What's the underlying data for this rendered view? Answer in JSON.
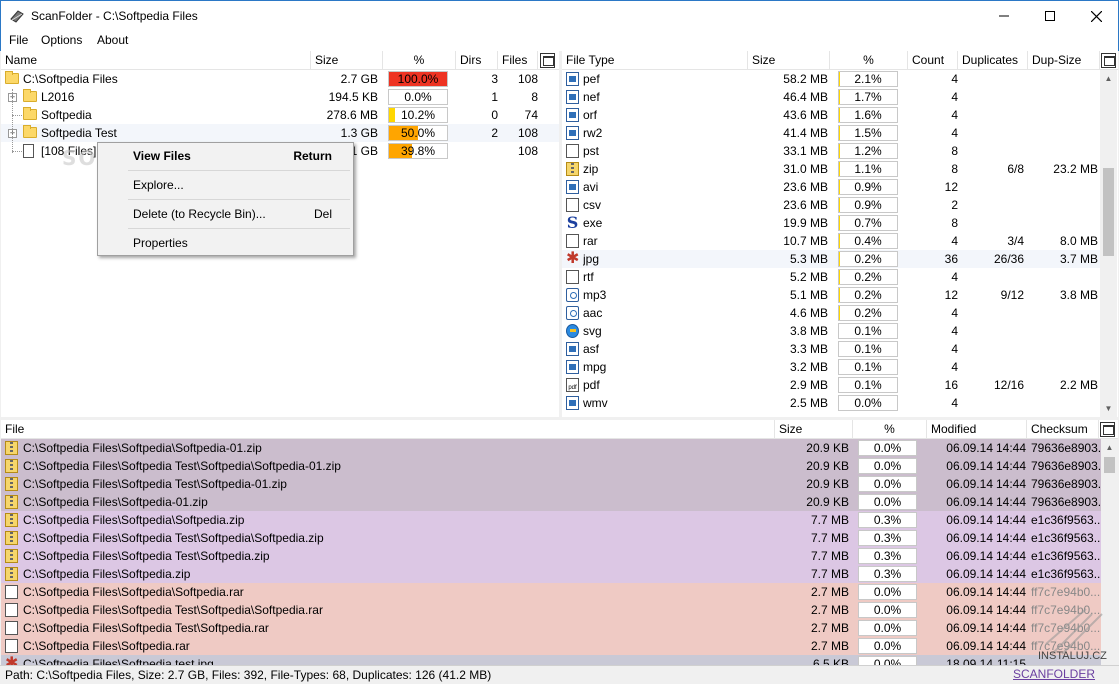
{
  "window": {
    "title": "ScanFolder - C:\\Softpedia Files",
    "minimize_glyph": "—",
    "maximize_glyph": "☐",
    "close_glyph": "✕"
  },
  "menu": [
    "File",
    "Options",
    "About"
  ],
  "folder_pane": {
    "headers": {
      "name": "Name",
      "size": "Size",
      "pct": "%",
      "dirs": "Dirs",
      "files": "Files"
    },
    "rows": [
      {
        "name": "C:\\Softpedia Files",
        "size": "2.7 GB",
        "pct": "100.0%",
        "pct_value": 100.0,
        "bar_color": "#ee3322",
        "dirs": "3",
        "files": "108",
        "icon": "folder-icon",
        "level": 0
      },
      {
        "name": "L2016",
        "size": "194.5 KB",
        "pct": "0.0%",
        "pct_value": 0.0,
        "bar_color": "#ffd700",
        "dirs": "1",
        "files": "8",
        "icon": "folder-icon",
        "level": 1,
        "expander": "+"
      },
      {
        "name": "Softpedia",
        "size": "278.6 MB",
        "pct": "10.2%",
        "pct_value": 10.2,
        "bar_color": "#ffd700",
        "dirs": "0",
        "files": "74",
        "icon": "folder-icon",
        "level": 1
      },
      {
        "name": "Softpedia Test",
        "size": "1.3 GB",
        "pct": "50.0%",
        "pct_value": 50.0,
        "bar_color": "#ffa500",
        "dirs": "2",
        "files": "108",
        "icon": "folder-icon",
        "level": 1,
        "expander": "+"
      },
      {
        "name": "[108 Files]",
        "size": "1 GB",
        "pct": "39.8%",
        "pct_value": 39.8,
        "bar_color": "#ffa500",
        "dirs": "",
        "files": "108",
        "icon": "file-icon",
        "level": 1
      }
    ]
  },
  "context_menu": {
    "items": [
      {
        "label": "View Files",
        "shortcut": "Return",
        "bold": true
      },
      {
        "label": "Explore...",
        "shortcut": ""
      },
      {
        "label": "Delete (to Recycle Bin)...",
        "shortcut": "Del"
      },
      {
        "label": "Properties",
        "shortcut": ""
      }
    ]
  },
  "watermark": "SOFTPEDIA",
  "type_pane": {
    "headers": {
      "type": "File Type",
      "size": "Size",
      "pct": "%",
      "count": "Count",
      "dups": "Duplicates",
      "dupsize": "Dup-Size"
    },
    "rows": [
      {
        "type": "pef",
        "size": "58.2 MB",
        "pct": "2.1%",
        "pct_value": 2.1,
        "count": "4",
        "dups": "",
        "dupsize": "",
        "icon": "img"
      },
      {
        "type": "nef",
        "size": "46.4 MB",
        "pct": "1.7%",
        "pct_value": 1.7,
        "count": "4",
        "dups": "",
        "dupsize": "",
        "icon": "img"
      },
      {
        "type": "orf",
        "size": "43.6 MB",
        "pct": "1.6%",
        "pct_value": 1.6,
        "count": "4",
        "dups": "",
        "dupsize": "",
        "icon": "img"
      },
      {
        "type": "rw2",
        "size": "41.4 MB",
        "pct": "1.5%",
        "pct_value": 1.5,
        "count": "4",
        "dups": "",
        "dupsize": "",
        "icon": "img"
      },
      {
        "type": "pst",
        "size": "33.1 MB",
        "pct": "1.2%",
        "pct_value": 1.2,
        "count": "8",
        "dups": "",
        "dupsize": "",
        "icon": "doc"
      },
      {
        "type": "zip",
        "size": "31.0 MB",
        "pct": "1.1%",
        "pct_value": 1.1,
        "count": "8",
        "dups": "6/8",
        "dupsize": "23.2 MB",
        "icon": "zip"
      },
      {
        "type": "avi",
        "size": "23.6 MB",
        "pct": "0.9%",
        "pct_value": 0.9,
        "count": "12",
        "dups": "",
        "dupsize": "",
        "icon": "img"
      },
      {
        "type": "csv",
        "size": "23.6 MB",
        "pct": "0.9%",
        "pct_value": 0.9,
        "count": "2",
        "dups": "",
        "dupsize": "",
        "icon": "doc"
      },
      {
        "type": "exe",
        "size": "19.9 MB",
        "pct": "0.7%",
        "pct_value": 0.7,
        "count": "8",
        "dups": "",
        "dupsize": "",
        "icon": "exe"
      },
      {
        "type": "rar",
        "size": "10.7 MB",
        "pct": "0.4%",
        "pct_value": 0.4,
        "count": "4",
        "dups": "3/4",
        "dupsize": "8.0 MB",
        "icon": "doc"
      },
      {
        "type": "jpg",
        "size": "5.3 MB",
        "pct": "0.2%",
        "pct_value": 0.2,
        "count": "36",
        "dups": "26/36",
        "dupsize": "3.7 MB",
        "icon": "jpg",
        "highlight": true
      },
      {
        "type": "rtf",
        "size": "5.2 MB",
        "pct": "0.2%",
        "pct_value": 0.2,
        "count": "4",
        "dups": "",
        "dupsize": "",
        "icon": "doc"
      },
      {
        "type": "mp3",
        "size": "5.1 MB",
        "pct": "0.2%",
        "pct_value": 0.2,
        "count": "12",
        "dups": "9/12",
        "dupsize": "3.8 MB",
        "icon": "mp3"
      },
      {
        "type": "aac",
        "size": "4.6 MB",
        "pct": "0.2%",
        "pct_value": 0.2,
        "count": "4",
        "dups": "",
        "dupsize": "",
        "icon": "mp3"
      },
      {
        "type": "svg",
        "size": "3.8 MB",
        "pct": "0.1%",
        "pct_value": 0.1,
        "count": "4",
        "dups": "",
        "dupsize": "",
        "icon": "svg"
      },
      {
        "type": "asf",
        "size": "3.3 MB",
        "pct": "0.1%",
        "pct_value": 0.1,
        "count": "4",
        "dups": "",
        "dupsize": "",
        "icon": "img"
      },
      {
        "type": "mpg",
        "size": "3.2 MB",
        "pct": "0.1%",
        "pct_value": 0.1,
        "count": "4",
        "dups": "",
        "dupsize": "",
        "icon": "img"
      },
      {
        "type": "pdf",
        "size": "2.9 MB",
        "pct": "0.1%",
        "pct_value": 0.1,
        "count": "16",
        "dups": "12/16",
        "dupsize": "2.2 MB",
        "icon": "pdf"
      },
      {
        "type": "wmv",
        "size": "2.5 MB",
        "pct": "0.0%",
        "pct_value": 0.0,
        "count": "4",
        "dups": "",
        "dupsize": "",
        "icon": "img"
      }
    ]
  },
  "file_pane": {
    "headers": {
      "file": "File",
      "size": "Size",
      "pct": "%",
      "modified": "Modified",
      "checksum": "Checksum"
    },
    "rows": [
      {
        "file": "C:\\Softpedia Files\\Softpedia\\Softpedia-01.zip",
        "size": "20.9 KB",
        "pct": "0.0%",
        "date": "06.09.14",
        "time": "14:44",
        "checksum": "79636e8903...",
        "bg": "#cbbdcd",
        "icon": "zip"
      },
      {
        "file": "C:\\Softpedia Files\\Softpedia Test\\Softpedia\\Softpedia-01.zip",
        "size": "20.9 KB",
        "pct": "0.0%",
        "date": "06.09.14",
        "time": "14:44",
        "checksum": "79636e8903...",
        "bg": "#cbbdcd",
        "icon": "zip"
      },
      {
        "file": "C:\\Softpedia Files\\Softpedia Test\\Softpedia-01.zip",
        "size": "20.9 KB",
        "pct": "0.0%",
        "date": "06.09.14",
        "time": "14:44",
        "checksum": "79636e8903...",
        "bg": "#cbbdcd",
        "icon": "zip"
      },
      {
        "file": "C:\\Softpedia Files\\Softpedia-01.zip",
        "size": "20.9 KB",
        "pct": "0.0%",
        "date": "06.09.14",
        "time": "14:44",
        "checksum": "79636e8903...",
        "bg": "#cbbdcd",
        "icon": "zip"
      },
      {
        "file": "C:\\Softpedia Files\\Softpedia\\Softpedia.zip",
        "size": "7.7 MB",
        "pct": "0.3%",
        "date": "06.09.14",
        "time": "14:44",
        "checksum": "e1c36f9563...",
        "bg": "#dcc7e4",
        "icon": "zip"
      },
      {
        "file": "C:\\Softpedia Files\\Softpedia Test\\Softpedia\\Softpedia.zip",
        "size": "7.7 MB",
        "pct": "0.3%",
        "date": "06.09.14",
        "time": "14:44",
        "checksum": "e1c36f9563...",
        "bg": "#dcc7e4",
        "icon": "zip"
      },
      {
        "file": "C:\\Softpedia Files\\Softpedia Test\\Softpedia.zip",
        "size": "7.7 MB",
        "pct": "0.3%",
        "date": "06.09.14",
        "time": "14:44",
        "checksum": "e1c36f9563...",
        "bg": "#dcc7e4",
        "icon": "zip"
      },
      {
        "file": "C:\\Softpedia Files\\Softpedia.zip",
        "size": "7.7 MB",
        "pct": "0.3%",
        "date": "06.09.14",
        "time": "14:44",
        "checksum": "e1c36f9563...",
        "bg": "#dcc7e4",
        "icon": "zip"
      },
      {
        "file": "C:\\Softpedia Files\\Softpedia\\Softpedia.rar",
        "size": "2.7 MB",
        "pct": "0.0%",
        "date": "06.09.14",
        "time": "14:44",
        "checksum": "ff7c7e94b0...",
        "bg": "#efcac4",
        "icon": "doc"
      },
      {
        "file": "C:\\Softpedia Files\\Softpedia Test\\Softpedia\\Softpedia.rar",
        "size": "2.7 MB",
        "pct": "0.0%",
        "date": "06.09.14",
        "time": "14:44",
        "checksum": "ff7c7e94b0...",
        "bg": "#efcac4",
        "icon": "doc"
      },
      {
        "file": "C:\\Softpedia Files\\Softpedia Test\\Softpedia.rar",
        "size": "2.7 MB",
        "pct": "0.0%",
        "date": "06.09.14",
        "time": "14:44",
        "checksum": "ff7c7e94b0...",
        "bg": "#efcac4",
        "icon": "doc"
      },
      {
        "file": "C:\\Softpedia Files\\Softpedia.rar",
        "size": "2.7 MB",
        "pct": "0.0%",
        "date": "06.09.14",
        "time": "14:44",
        "checksum": "ff7c7e94b0...",
        "bg": "#efcac4",
        "icon": "doc"
      },
      {
        "file": "C:\\Softpedia Files\\Softpedia test.jpg",
        "size": "6.5 KB",
        "pct": "0.0%",
        "date": "18.09.14",
        "time": "11:15",
        "checksum": "",
        "bg": "#c9c9d6",
        "icon": "jpg"
      }
    ]
  },
  "status": {
    "text": "Path: C:\\Softpedia Files, Size: 2.7 GB, Files: 392, File-Types: 68, Duplicates: 126 (41.2 MB)",
    "link": "SCANFOLDER"
  },
  "site_watermark": "INSTALUJ.CZ"
}
